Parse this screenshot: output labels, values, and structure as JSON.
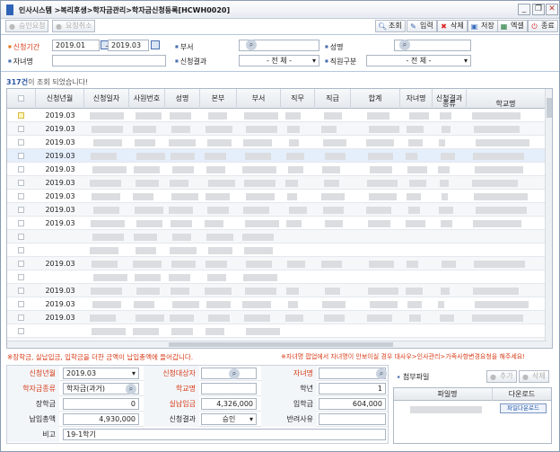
{
  "title": {
    "text": "인사시스템 >복리후생>학자금관리>학자금신청등록[HCWH0020]"
  },
  "window_buttons": [
    "_",
    "❐",
    "✕"
  ],
  "toolbar": {
    "approval_request": "승인요청",
    "approval_cancel": "요청취소",
    "search": "조회",
    "input": "입력",
    "delete": "삭제",
    "save": "저장",
    "excel": "엑셀",
    "close": "종료"
  },
  "filters": {
    "period_label": "신청기간",
    "period_from": "2019.01",
    "period_sep": "~",
    "period_to": "2019.03",
    "dept_label": "부서",
    "name_label": "성명",
    "child_label": "자녀명",
    "result_label": "신청결과",
    "result_value": "- 전 체 -",
    "jobtype_label": "직원구분",
    "jobtype_value": "- 전 체 -"
  },
  "count": {
    "number": "317건",
    "suffix": "이 조회 되었습니다!"
  },
  "grid": {
    "columns": [
      "",
      "신청년월",
      "신청일자",
      "사원번호",
      "성명",
      "본부",
      "부서",
      "직무",
      "직급",
      "합계",
      "자녀명",
      "신청결과",
      "종류",
      "학교명"
    ],
    "rows": [
      "2019.03",
      "2019.03",
      "2019.03",
      "2019.03",
      "2019.03",
      "2019.03",
      "2019.03",
      "2019.03",
      "2019.03",
      "",
      "",
      "2019.03",
      "",
      "2019.03",
      "2019.03",
      "2019.03",
      "",
      "2019.03"
    ]
  },
  "notes": {
    "left": "장학금, 실납입금, 입학금을 더한 금액이 납입총액에 들어갑니다.",
    "right": "자녀명 팝업에서 자녀명이 안보이실 경우 대사우>인사관리>가족사항변경요청을 해주세요!"
  },
  "detail": {
    "req_month_label": "신청년월",
    "req_month_value": "2019.03",
    "target_label": "신청대상자",
    "child_label": "자녀명",
    "kind_label": "학자금종류",
    "kind_value": "학자금(과거)",
    "school_label": "학교명",
    "grade_label": "학년",
    "grade_value": "1",
    "scholarship_label": "장학금",
    "scholarship_value": "0",
    "paid_label": "실납입금",
    "paid_value": "4,326,000",
    "entrance_label": "입학금",
    "entrance_value": "604,000",
    "total_label": "납입총액",
    "total_value": "4,930,000",
    "result_label": "신청결과",
    "result_value": "승인",
    "reject_label": "반려사유",
    "memo_label": "비고",
    "memo_value": "19-1학기"
  },
  "attach": {
    "title": "첨부파일",
    "add": "추가",
    "remove": "삭제",
    "col_file": "파일명",
    "col_download": "다운로드",
    "download_btn": "파일다운로드"
  }
}
